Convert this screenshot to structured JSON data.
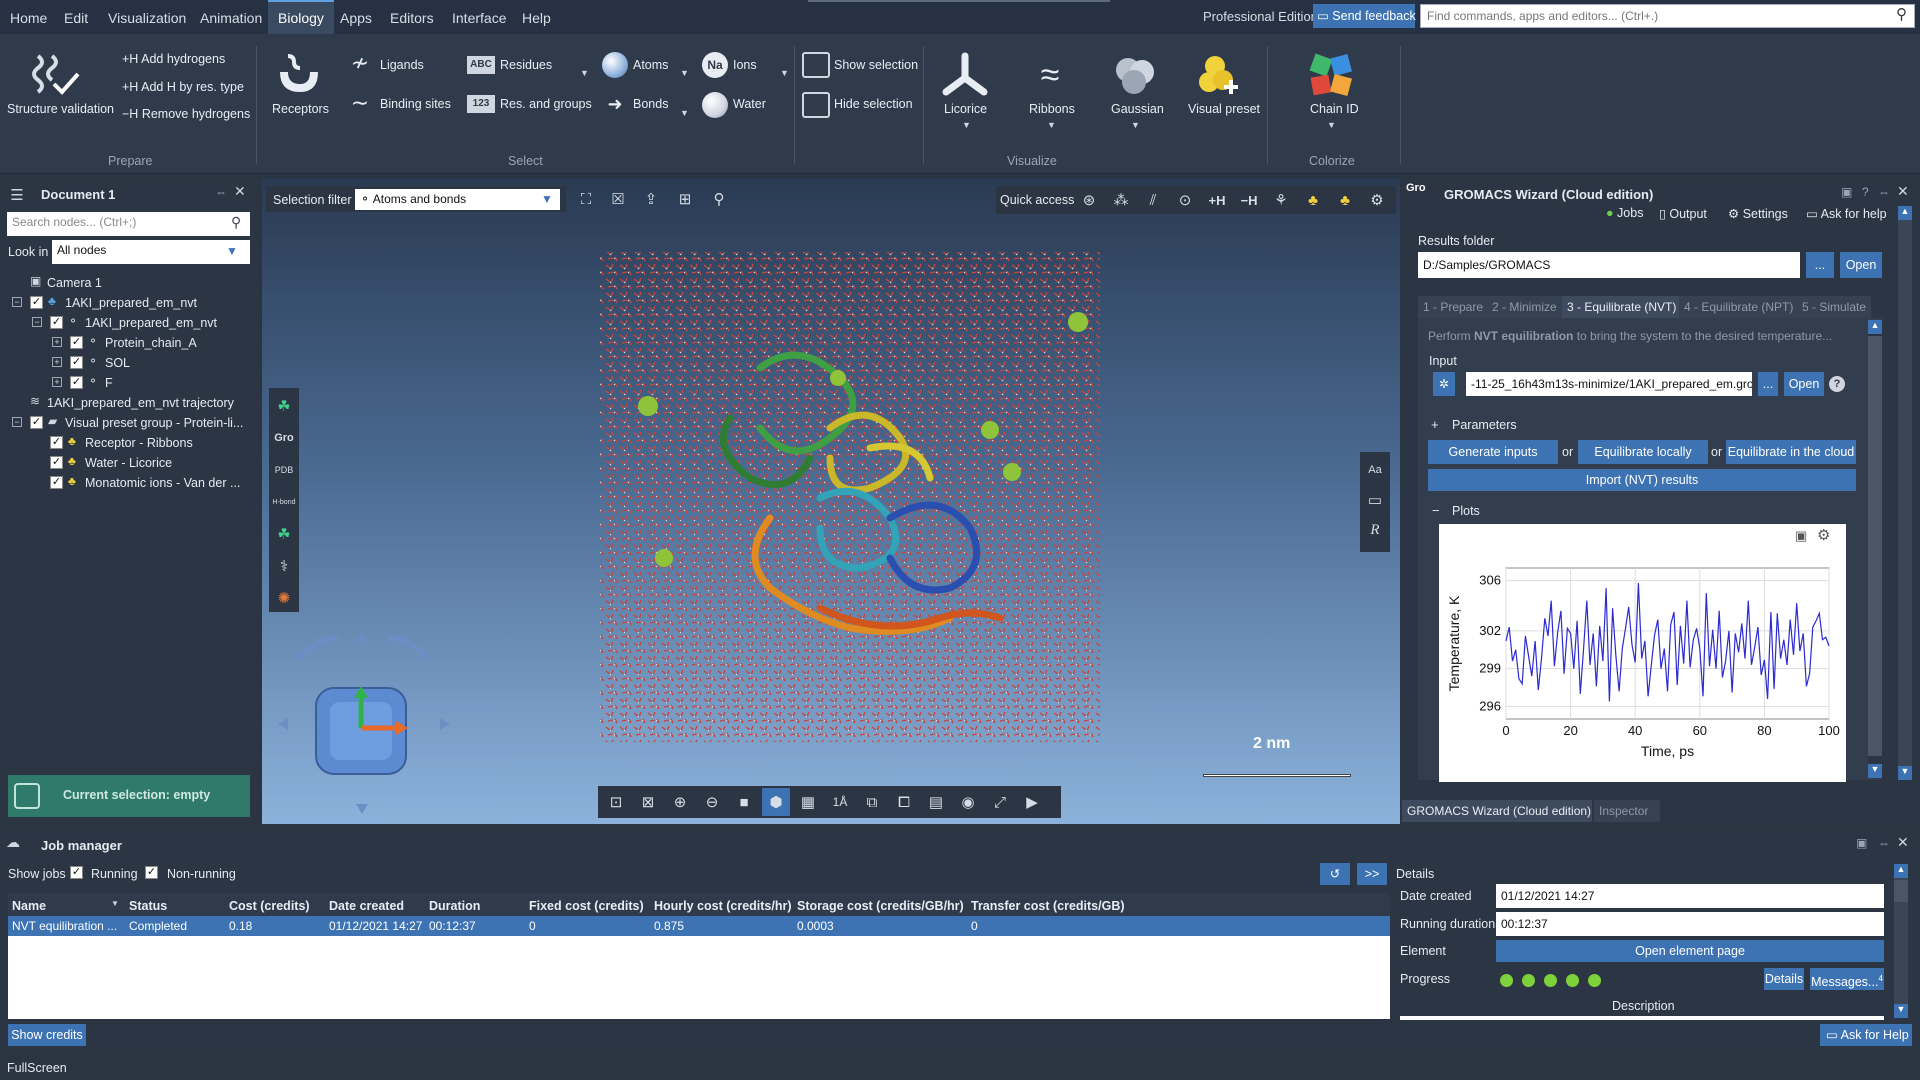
{
  "menu": {
    "items": [
      "Home",
      "Edit",
      "Visualization",
      "Animation",
      "Biology",
      "Apps",
      "Editors",
      "Interface",
      "Help"
    ],
    "active": "Biology"
  },
  "header": {
    "edition": "Professional Edition",
    "feedback": "Send feedback",
    "search_placeholder": "Find commands, apps and editors... (Ctrl+.)"
  },
  "ribbon": {
    "prepare": {
      "validation": "Structure validation",
      "add_h": "Add hydrogens",
      "add_h_res": "Add H by res. type",
      "remove_h": "Remove hydrogens",
      "h_prefix_add": "+H",
      "h_prefix_remove": "−H",
      "group": "Prepare"
    },
    "select": {
      "receptors": "Receptors",
      "ligands": "Ligands",
      "binding_sites": "Binding sites",
      "residues": "Residues",
      "res_groups": "Res. and groups",
      "atoms": "Atoms",
      "bonds": "Bonds",
      "ions": "Ions",
      "water": "Water",
      "show_sel": "Show selection",
      "hide_sel": "Hide selection",
      "abc_badge": "ABC",
      "num_badge": "123",
      "na_badge": "Na",
      "group": "Select"
    },
    "visualize": {
      "licorice": "Licorice",
      "ribbons": "Ribbons",
      "gaussian": "Gaussian",
      "visual_preset": "Visual preset",
      "group": "Visualize"
    },
    "colorize": {
      "chain_id": "Chain ID",
      "group": "Colorize"
    }
  },
  "document": {
    "title": "Document 1",
    "search_placeholder": "Search nodes... (Ctrl+;)",
    "look_in_label": "Look in",
    "look_in_value": "All nodes",
    "tree": [
      {
        "label": "Camera 1",
        "checkbox": false,
        "expander": false,
        "checked": false
      },
      {
        "label": "1AKI_prepared_em_nvt",
        "checkbox": true,
        "expander": true,
        "checked": true
      },
      {
        "label": "1AKI_prepared_em_nvt",
        "checkbox": true,
        "expander": true,
        "checked": true
      },
      {
        "label": "Protein_chain_A",
        "checkbox": true,
        "expander": true,
        "checked": true
      },
      {
        "label": "SOL",
        "checkbox": true,
        "expander": true,
        "checked": true
      },
      {
        "label": "F",
        "checkbox": true,
        "expander": true,
        "checked": true
      },
      {
        "label": "1AKI_prepared_em_nvt trajectory",
        "checkbox": false,
        "expander": false,
        "checked": false
      },
      {
        "label": "Visual preset group - Protein-li...",
        "checkbox": true,
        "expander": true,
        "checked": true
      },
      {
        "label": "Receptor - Ribbons",
        "checkbox": true,
        "expander": false,
        "checked": true
      },
      {
        "label": "Water - Licorice",
        "checkbox": true,
        "expander": false,
        "checked": true
      },
      {
        "label": "Monatomic ions - Van der ...",
        "checkbox": true,
        "expander": false,
        "checked": true
      }
    ],
    "current_selection": "Current selection: empty"
  },
  "viewport": {
    "selection_filter_label": "Selection filter",
    "selection_filter_value": "Atoms and bonds",
    "quick_access": "Quick access",
    "qa_h_add": "+H",
    "qa_h_remove": "−H",
    "scale_bar": "2 nm",
    "side_gro": "Gro",
    "side_pdb": "PDB",
    "side_hbond": "H-bond",
    "right_aa": "Aa",
    "right_r": "R"
  },
  "wizard": {
    "title": "GROMACS Wizard (Cloud edition)",
    "badge": "Gro",
    "links": [
      "Jobs",
      "Output",
      "Settings",
      "Ask for help"
    ],
    "results_folder_label": "Results folder",
    "results_folder_value": "D:/Samples/GROMACS",
    "browse": "...",
    "open": "Open",
    "tabs": [
      "1 - Prepare",
      "2 - Minimize",
      "3 - Equilibrate (NVT)",
      "4 - Equilibrate (NPT)",
      "5 - Simulate"
    ],
    "active_tab": 2,
    "desc_pre": "Perform ",
    "desc_bold": "NVT equilibration",
    "desc_post": " to bring the system to the desired temperature...",
    "input_label": "Input",
    "input_value": "-11-25_16h43m13s-minimize/1AKI_prepared_em.gro",
    "help": "?",
    "parameters": "Parameters",
    "generate": "Generate inputs",
    "or": "or",
    "eq_locally": "Equilibrate locally",
    "eq_cloud": "Equilibrate in the cloud",
    "import": "Import (NVT) results",
    "plots": "Plots",
    "expand": "+",
    "collapse": "−"
  },
  "bottom_tabs": [
    "GROMACS Wizard (Cloud edition)",
    "Inspector"
  ],
  "chart_data": {
    "type": "line",
    "xlabel": "Time, ps",
    "ylabel": "Temperature, K",
    "xlim": [
      0,
      100
    ],
    "ylim": [
      295,
      307
    ],
    "xticks": [
      0,
      20,
      40,
      60,
      80,
      100
    ],
    "yticks": [
      296,
      299,
      302,
      306
    ],
    "grid": true,
    "line_color": "#2b2bd0",
    "x": [
      0,
      1,
      2,
      3,
      4,
      5,
      6,
      7,
      8,
      9,
      10,
      11,
      12,
      13,
      14,
      15,
      16,
      17,
      18,
      19,
      20,
      21,
      22,
      23,
      24,
      25,
      26,
      27,
      28,
      29,
      30,
      31,
      32,
      33,
      34,
      35,
      36,
      37,
      38,
      39,
      40,
      41,
      42,
      43,
      44,
      45,
      46,
      47,
      48,
      49,
      50,
      51,
      52,
      53,
      54,
      55,
      56,
      57,
      58,
      59,
      60,
      61,
      62,
      63,
      64,
      65,
      66,
      67,
      68,
      69,
      70,
      71,
      72,
      73,
      74,
      75,
      76,
      77,
      78,
      79,
      80,
      81,
      82,
      83,
      84,
      85,
      86,
      87,
      88,
      89,
      90,
      91,
      92,
      93,
      94,
      95,
      96,
      97,
      98,
      99,
      100
    ],
    "values": [
      301.2,
      302.3,
      299.6,
      300.5,
      298.2,
      297.8,
      301.6,
      300.0,
      298.4,
      301.2,
      297.3,
      299.8,
      303.0,
      301.6,
      304.4,
      299.2,
      301.9,
      303.6,
      298.6,
      302.2,
      301.8,
      299.0,
      302.8,
      297.0,
      300.5,
      304.4,
      299.3,
      301.8,
      297.6,
      302.4,
      299.6,
      305.4,
      296.4,
      303.8,
      300.1,
      297.2,
      300.6,
      302.2,
      303.9,
      300.9,
      299.5,
      305.8,
      299.8,
      301.2,
      296.8,
      299.3,
      301.7,
      302.9,
      299.0,
      300.6,
      297.2,
      302.5,
      303.5,
      297.7,
      302.4,
      299.4,
      304.4,
      299.1,
      301.3,
      302.2,
      300.6,
      296.8,
      305.0,
      299.2,
      302.1,
      299.0,
      303.6,
      298.3,
      299.6,
      302.0,
      297.1,
      301.8,
      300.3,
      302.6,
      299.8,
      304.4,
      299.3,
      300.7,
      302.3,
      298.5,
      299.7,
      296.6,
      303.5,
      297.4,
      303.4,
      299.8,
      301.3,
      299.3,
      302.9,
      300.1,
      304.2,
      300.4,
      301.8,
      297.6,
      298.6,
      302.3,
      302.8,
      303.4,
      301.3,
      301.5,
      300.8
    ]
  },
  "job_manager": {
    "title": "Job manager",
    "show_jobs": "Show jobs",
    "running": "Running",
    "non_running": "Non-running",
    "columns": [
      "Name",
      "Status",
      "Cost (credits)",
      "Date created",
      "Duration",
      "Fixed cost (credits)",
      "Hourly cost (credits/hr)",
      "Storage cost (credits/GB/hr)",
      "Transfer cost (credits/GB)"
    ],
    "row": [
      "NVT equilibration ...",
      "Completed",
      "0.18",
      "01/12/2021 14:27",
      "00:12:37",
      "0",
      "0.875",
      "0.0003",
      "0"
    ],
    "show_credits": "Show credits",
    "forward": ">>",
    "details": {
      "title": "Details",
      "date_created_label": "Date created",
      "date_created": "01/12/2021 14:27",
      "running_duration_label": "Running duration",
      "running_duration": "00:12:37",
      "element_label": "Element",
      "open_element": "Open element page",
      "progress_label": "Progress",
      "progress_dots": 5,
      "details_btn": "Details",
      "messages_btn": "Messages...",
      "messages_count": "4",
      "description": "Description"
    },
    "ask_help": "Ask for Help"
  },
  "status_bar": {
    "text": "FullScreen"
  }
}
